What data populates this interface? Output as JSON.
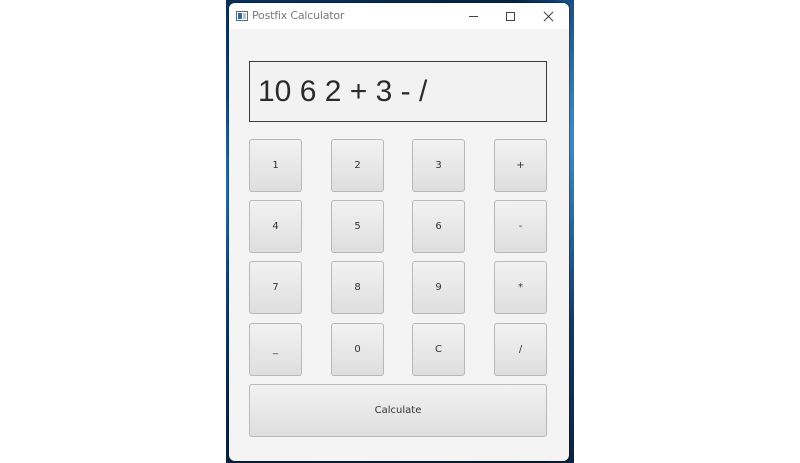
{
  "window": {
    "title": "Postfix Calculator",
    "icons": {
      "app": "app-window-icon",
      "minimize": "minimize-icon",
      "maximize": "maximize-icon",
      "close": "close-icon"
    }
  },
  "display": {
    "value": "10 6 2 + 3 - /"
  },
  "keypad": {
    "rows": [
      [
        "1",
        "2",
        "3",
        "+"
      ],
      [
        "4",
        "5",
        "6",
        "-"
      ],
      [
        "7",
        "8",
        "9",
        "*"
      ],
      [
        "_",
        "0",
        "C",
        "/"
      ]
    ]
  },
  "calculate_label": "Calculate",
  "colors": {
    "window_bg": "#f4f4f4",
    "titlebar_bg": "#ffffff",
    "display_border": "#3b3b3b"
  }
}
